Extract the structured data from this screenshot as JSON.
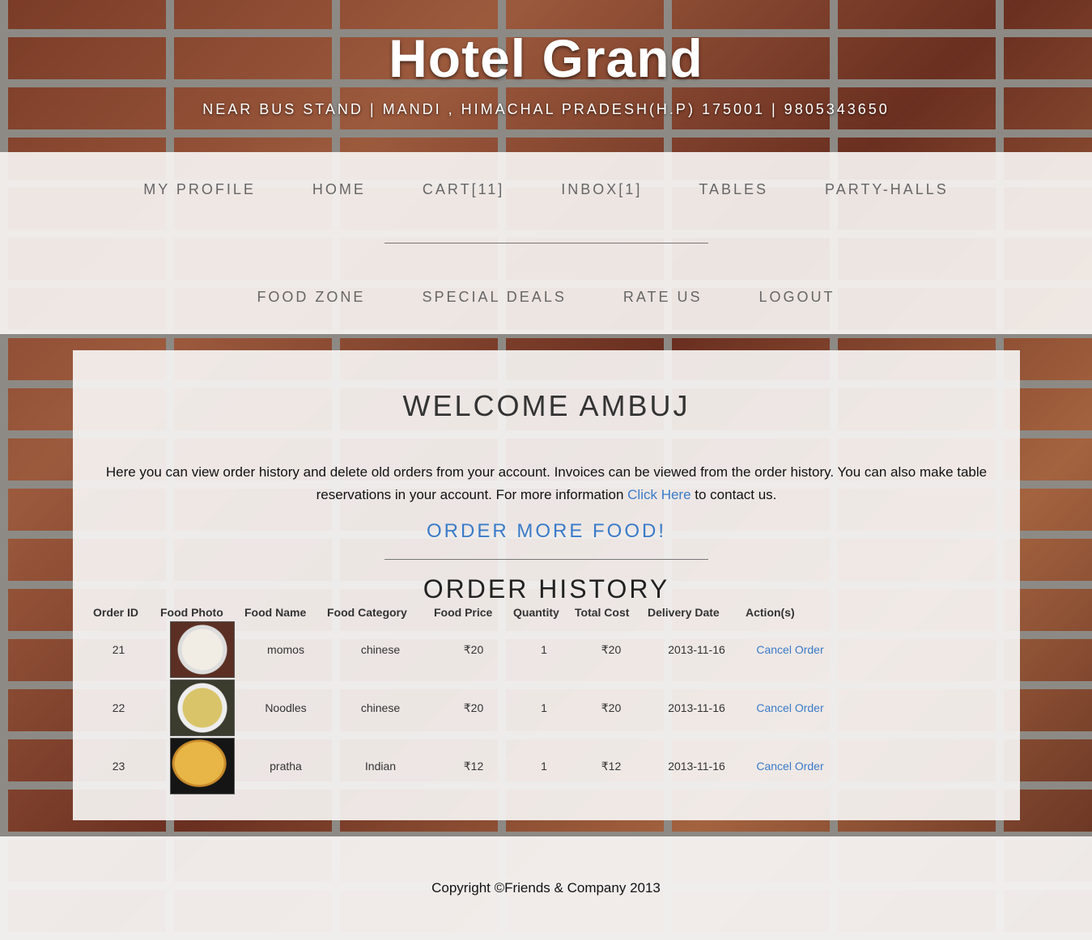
{
  "header": {
    "title": "Hotel Grand",
    "address": "NEAR BUS STAND | MANDI , HIMACHAL PRADESH(H.P) 175001 | 9805343650"
  },
  "nav": {
    "row1": [
      "MY PROFILE",
      "HOME",
      "CART[11]",
      "INBOX[1]",
      "TABLES",
      "PARTY-HALLS"
    ],
    "row2": [
      "FOOD ZONE",
      "SPECIAL DEALS",
      "RATE US",
      "LOGOUT"
    ]
  },
  "main": {
    "welcome": "WELCOME AMBUJ",
    "intro_text": "Here you can view order history and delete old orders from your account. Invoices can be viewed from the order history. You can also make table reservations in your account. For more information",
    "intro_link": "Click Here",
    "intro_suffix": "to contact us.",
    "order_more": "ORDER MORE FOOD!",
    "history_title": "ORDER HISTORY"
  },
  "orders": {
    "headers": [
      "Order ID",
      "Food Photo",
      "Food Name",
      "Food Category",
      "Food Price",
      "Quantity",
      "Total Cost",
      "Delivery Date",
      "Action(s)"
    ],
    "rows": [
      {
        "id": "21",
        "photo": "momos-photo",
        "name": "momos",
        "category": "chinese",
        "price": "₹20",
        "quantity": "1",
        "total": "₹20",
        "date": "2013-11-16",
        "action": "Cancel Order"
      },
      {
        "id": "22",
        "photo": "noodles-photo",
        "name": "Noodles",
        "category": "chinese",
        "price": "₹20",
        "quantity": "1",
        "total": "₹20",
        "date": "2013-11-16",
        "action": "Cancel Order"
      },
      {
        "id": "23",
        "photo": "pratha-photo",
        "name": "pratha",
        "category": "Indian",
        "price": "₹12",
        "quantity": "1",
        "total": "₹12",
        "date": "2013-11-16",
        "action": "Cancel Order"
      }
    ]
  },
  "footer": {
    "copyright": "Copyright ©Friends & Company 2013"
  },
  "colors": {
    "link": "#3a7bc8",
    "nav_text": "#666666"
  }
}
